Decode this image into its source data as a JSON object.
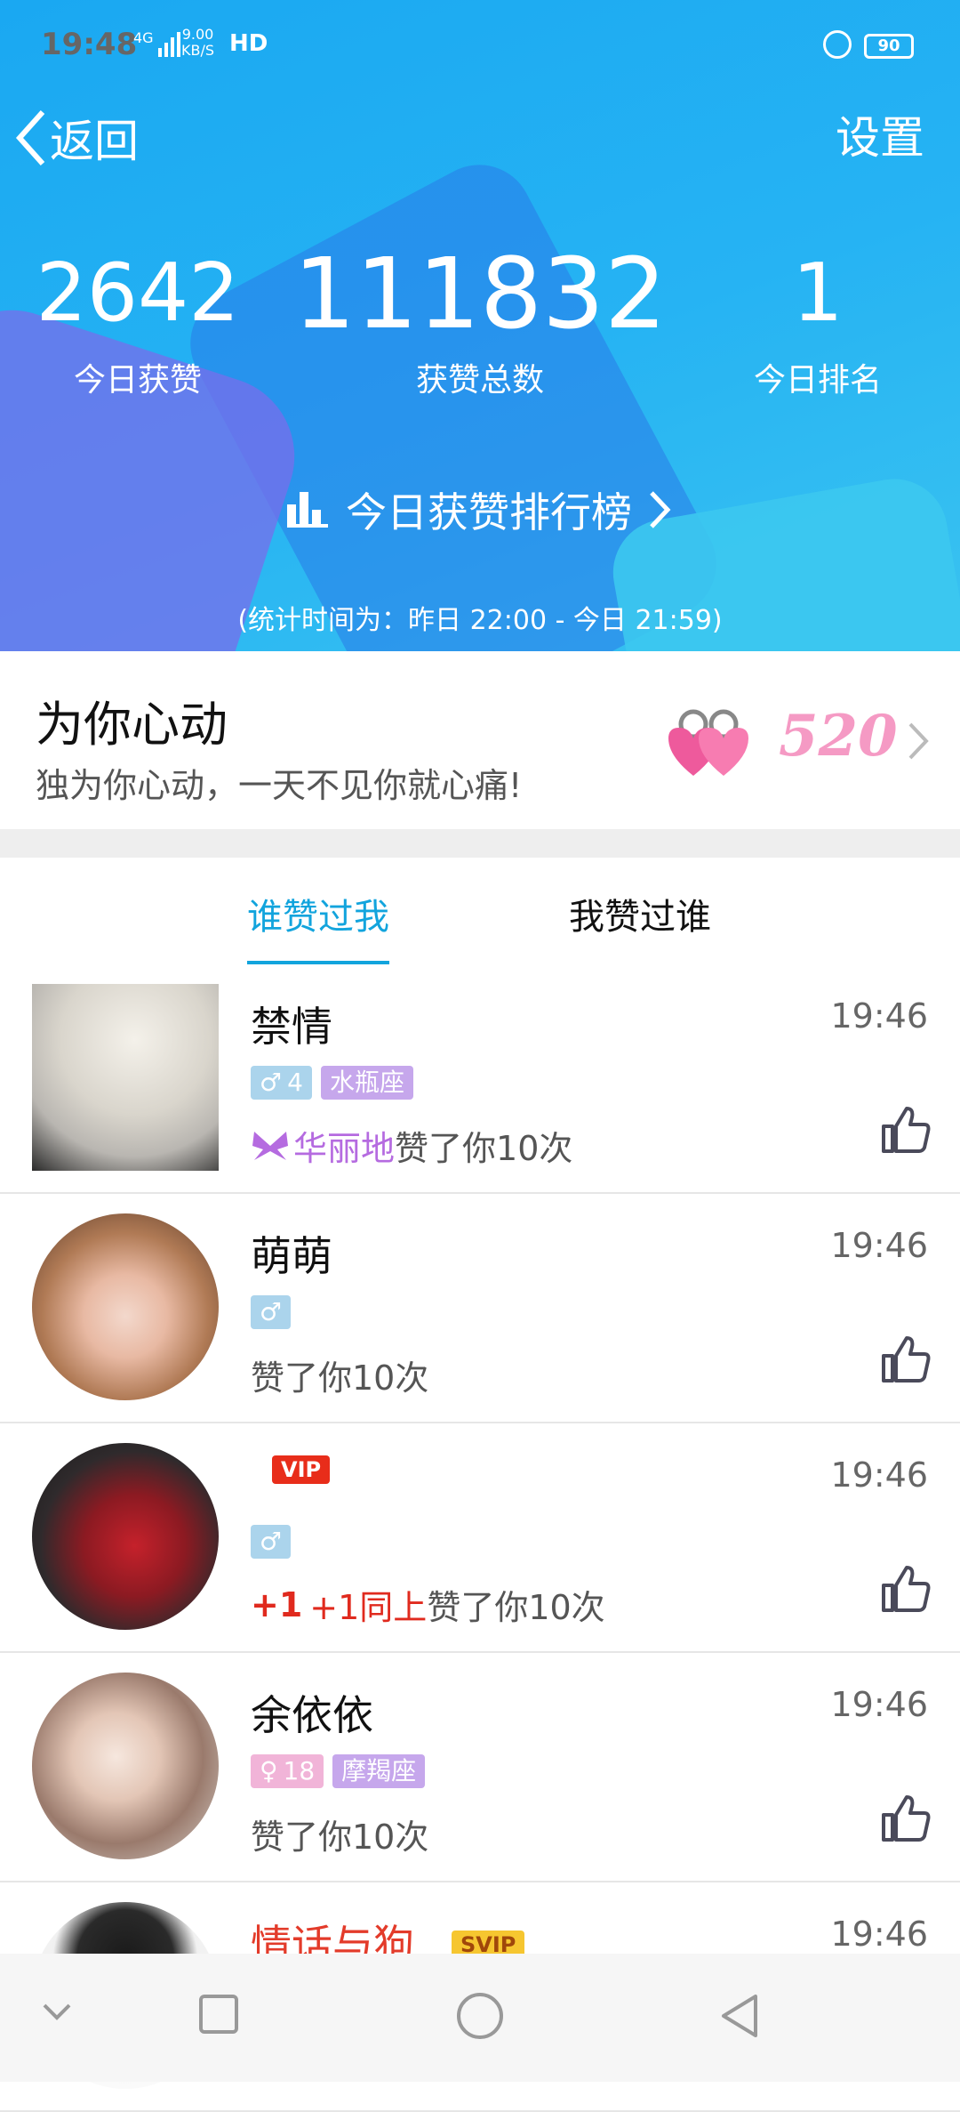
{
  "status": {
    "time": "19:48",
    "network": "4G",
    "speed_value": "9.00",
    "speed_unit": "KB/S",
    "hd": "HD",
    "battery": "90"
  },
  "header": {
    "back_label": "返回",
    "settings_label": "设置"
  },
  "stats": [
    {
      "value": "2642",
      "label": "今日获赞"
    },
    {
      "value": "111832",
      "label": "获赞总数"
    },
    {
      "value": "1",
      "label": "今日排名"
    }
  ],
  "ranking_label": "今日获赞排行榜",
  "period": "(统计时间为：昨日 22:00 - 今日 21:59)",
  "banner": {
    "title": "为你心动",
    "subtitle": "独为你心动，一天不见你就心痛!",
    "badge": "520"
  },
  "tabs": [
    "谁赞过我",
    "我赞过谁"
  ],
  "rows": [
    {
      "name": "禁情",
      "time": "19:46",
      "gender": "♂",
      "age": "4",
      "zodiac": "水瓶座",
      "badge": "华丽地",
      "liked": "赞了你10次"
    },
    {
      "name": "萌萌",
      "time": "19:46",
      "gender": "♂",
      "liked": "赞了你10次"
    },
    {
      "name": "",
      "vip": "VIP",
      "time": "19:46",
      "gender": "♂",
      "plus": "+1",
      "red_text": "+1同上",
      "liked": "赞了你10次"
    },
    {
      "name": "余依依",
      "time": "19:46",
      "gender": "♀",
      "age": "18",
      "zodiac": "摩羯座",
      "liked": "赞了你10次"
    },
    {
      "name": "情话与狗.",
      "svip": "SVIP",
      "time": "19:46"
    }
  ],
  "colors": {
    "accent": "#12a4dd",
    "header_bg": "#1aa8f2"
  }
}
